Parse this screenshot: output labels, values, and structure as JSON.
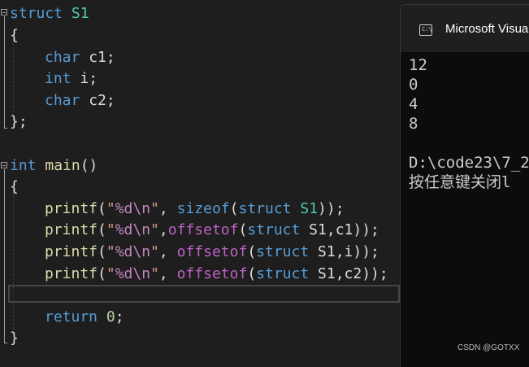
{
  "editor": {
    "lines": {
      "struct_decl": {
        "kw": "struct",
        "name": "S1"
      },
      "open1": "{",
      "m1": {
        "type": "char",
        "name": "c1;"
      },
      "m2": {
        "type": "int",
        "name": "i;"
      },
      "m3": {
        "type": "char",
        "name": "c2;"
      },
      "close1": "};",
      "main_decl": {
        "kw": "int",
        "fn": "main",
        "rest": "()"
      },
      "open2": "{",
      "p1": {
        "fn": "printf",
        "open": "(",
        "q1": "\"",
        "fmt": "%d\\n",
        "q2": "\"",
        "sep": ", ",
        "op": "sizeof",
        "p": "(",
        "kw": "struct",
        "arg": " S1",
        "end": "));"
      },
      "p2": {
        "fn": "printf",
        "open": "(",
        "q1": "\"",
        "fmt": "%d\\n",
        "q2": "\"",
        "sep": ",",
        "op": "offsetof",
        "p": "(",
        "kw": "struct",
        "arg": " S1,c1",
        "end": "));"
      },
      "p3": {
        "fn": "printf",
        "open": "(",
        "q1": "\"",
        "fmt": "%d\\n",
        "q2": "\"",
        "sep": ", ",
        "op": "offsetof",
        "p": "(",
        "kw": "struct",
        "arg": " S1,i",
        "end": "));"
      },
      "p4": {
        "fn": "printf",
        "open": "(",
        "q1": "\"",
        "fmt": "%d\\n",
        "q2": "\"",
        "sep": ", ",
        "op": "offsetof",
        "p": "(",
        "kw": "struct",
        "arg": " S1,c2",
        "end": "));"
      },
      "ret": {
        "kw": "return",
        "val": "0",
        "end": ";"
      },
      "close2": "}"
    }
  },
  "console": {
    "title": "Microsoft Visua",
    "icon": "console-app-icon",
    "icon_text": "C:\\",
    "output": [
      "12",
      "0",
      "4",
      "8",
      "",
      "D:\\code23\\7_2",
      "按任意键关闭l"
    ]
  },
  "watermark": "CSDN @GOTXX"
}
